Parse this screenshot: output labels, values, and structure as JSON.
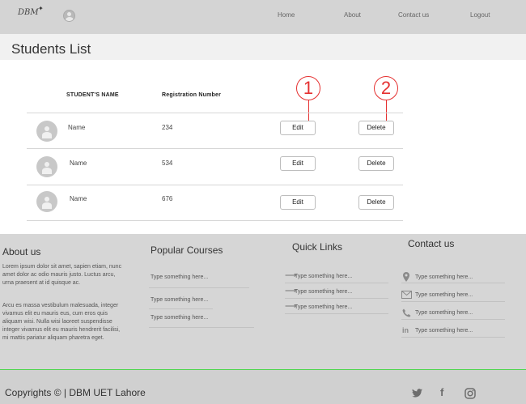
{
  "nav": {
    "logo": "DBM",
    "links": [
      "Home",
      "About",
      "Contact us",
      "Logout"
    ]
  },
  "page": {
    "title": "Students List"
  },
  "table": {
    "headers": {
      "name": "STUDENT'S  NAME",
      "reg": "Registration Number"
    },
    "rows": [
      {
        "name": "Name",
        "reg": "234"
      },
      {
        "name": "Name",
        "reg": "534"
      },
      {
        "name": "Name",
        "reg": "676"
      }
    ],
    "edit_label": "Edit",
    "delete_label": "Delete"
  },
  "callouts": [
    "1",
    "2"
  ],
  "footer": {
    "about": {
      "title": "About us",
      "para1": "Lorem ipsum dolor sit amet, sapien etiam, nunc amet dolor ac odio mauris justo. Luctus arcu, urna praesent at id quisque ac.",
      "para2": "Arcu es massa vestibulum malesuada, integer vivamus elit eu mauris eus, cum eros quis aliquam wisi. Nulla wisi laoreet suspendisse integer vivamus elit eu mauris hendrerit facilisi, mi mattis pariatur aliquam pharetra eget."
    },
    "courses": {
      "title": "Popular Courses",
      "items": [
        "Type something here...",
        "Type something here...",
        "Type something here..."
      ]
    },
    "links": {
      "title": "Quick Links",
      "items": [
        "Type something here...",
        "Type something here...",
        "Type something here..."
      ]
    },
    "contact": {
      "title": "Contact us",
      "items": [
        "Type something here...",
        "Type something here...",
        "Type something here...",
        "Type something here..."
      ]
    },
    "icons": {
      "contact": [
        "location-icon",
        "mail-icon",
        "phone-icon",
        "linkedin-icon"
      ],
      "social": [
        "twitter-icon",
        "facebook-icon",
        "instagram-icon"
      ]
    }
  },
  "copyright": "Copyrights © | DBM UET Lahore",
  "colors": {
    "callout": "#e53030",
    "footer_accent": "#4fd64f"
  }
}
